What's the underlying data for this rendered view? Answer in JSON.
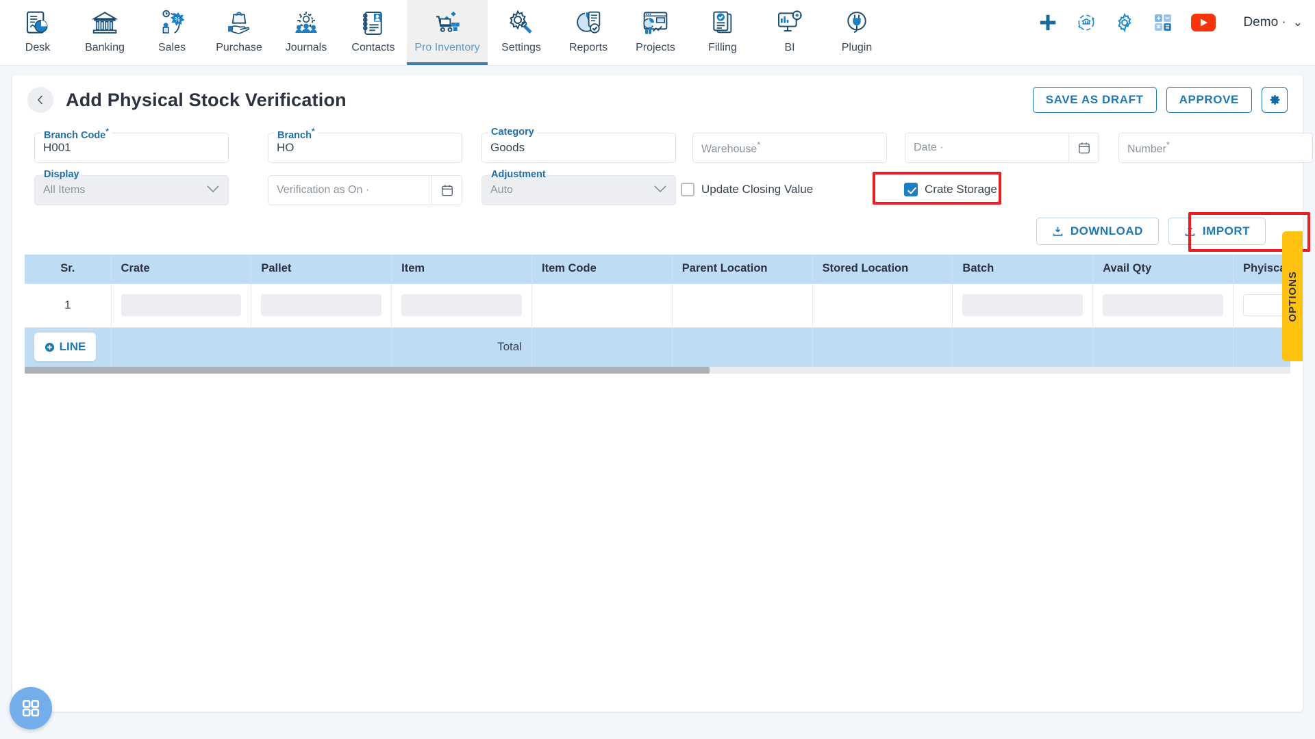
{
  "topnav": {
    "items": [
      {
        "label": "Desk",
        "icon": "desk-chart-icon",
        "active": false
      },
      {
        "label": "Banking",
        "icon": "bank-icon",
        "active": false
      },
      {
        "label": "Sales",
        "icon": "sales-megaphone-icon",
        "active": false
      },
      {
        "label": "Purchase",
        "icon": "purchase-bag-hand-icon",
        "active": false
      },
      {
        "label": "Journals",
        "icon": "journals-people-gear-icon",
        "active": false
      },
      {
        "label": "Contacts",
        "icon": "contacts-book-icon",
        "active": false
      },
      {
        "label": "Pro Inventory",
        "icon": "inventory-cart-icon",
        "active": true
      },
      {
        "label": "Settings",
        "icon": "settings-gear-wrench-icon",
        "active": false
      },
      {
        "label": "Reports",
        "icon": "reports-pie-icon",
        "active": false
      },
      {
        "label": "Projects",
        "icon": "projects-dashboard-icon",
        "active": false
      },
      {
        "label": "Filling",
        "icon": "filling-docs-check-icon",
        "active": false
      },
      {
        "label": "BI",
        "icon": "bi-monitor-icon",
        "active": false
      },
      {
        "label": "Plugin",
        "icon": "plugin-plug-icon",
        "active": false
      }
    ],
    "right_icons": [
      {
        "name": "add-plus-icon"
      },
      {
        "name": "bank-sync-icon"
      },
      {
        "name": "gear-icon"
      },
      {
        "name": "calculator-icon"
      },
      {
        "name": "youtube-icon"
      }
    ],
    "user": {
      "label": "Demo ·",
      "chevron": "⌄"
    }
  },
  "header": {
    "back_icon": "chevron-left-icon",
    "title": "Add Physical Stock Verification",
    "save_as_draft": "SAVE AS DRAFT",
    "approve": "APPROVE",
    "settings_icon": "gear-icon"
  },
  "form": {
    "branch_code": {
      "legend": "Branch Code",
      "required": true,
      "value": "H001"
    },
    "branch": {
      "legend": "Branch",
      "required": true,
      "value": "HO"
    },
    "category": {
      "legend": "Category",
      "required": false,
      "value": "Goods"
    },
    "warehouse": {
      "placeholder": "Warehouse",
      "required": true,
      "value": ""
    },
    "date": {
      "placeholder": "Date ·",
      "required": false,
      "value": "",
      "icon": "calendar-icon"
    },
    "number": {
      "placeholder": "Number",
      "required": true,
      "value": ""
    },
    "display": {
      "legend": "Display",
      "value": "All Items",
      "disabled": true,
      "icon": "chevron-down-icon"
    },
    "verification_as_on": {
      "placeholder": "Verification as On ·",
      "value": "",
      "icon": "calendar-icon"
    },
    "adjustment": {
      "legend": "Adjustment",
      "value": "Auto",
      "disabled": true,
      "icon": "chevron-down-icon"
    },
    "update_closing_value": {
      "label": "Update Closing Value",
      "checked": false
    },
    "crate_storage": {
      "label": "Crate Storage",
      "checked": true
    }
  },
  "actions": {
    "download": "DOWNLOAD",
    "download_icon": "download-icon",
    "import": "IMPORT",
    "import_icon": "upload-icon"
  },
  "table": {
    "columns": [
      "Sr.",
      "Crate",
      "Pallet",
      "Item",
      "Item Code",
      "Parent Location",
      "Stored Location",
      "Batch",
      "Avail Qty",
      "Phyiscal Stock"
    ],
    "rows": [
      {
        "sr": "1",
        "crate": "",
        "pallet": "",
        "item": "",
        "item_code": "",
        "parent_location": "",
        "stored_location": "",
        "batch": "",
        "avail_qty": "",
        "physical_stock": ""
      }
    ],
    "footer": {
      "line_button": "LINE",
      "line_icon": "plus-circle-icon",
      "total_label": "Total"
    }
  },
  "side_tab": {
    "label": "OPTIONS"
  },
  "fab": {
    "icon": "grid-apps-icon"
  },
  "colors": {
    "accent_blue": "#1f78b4",
    "header_blue": "#bfdcf5",
    "highlight_red": "#ec1c24",
    "options_yellow": "#ffc211",
    "fab_blue": "#74aeea"
  }
}
